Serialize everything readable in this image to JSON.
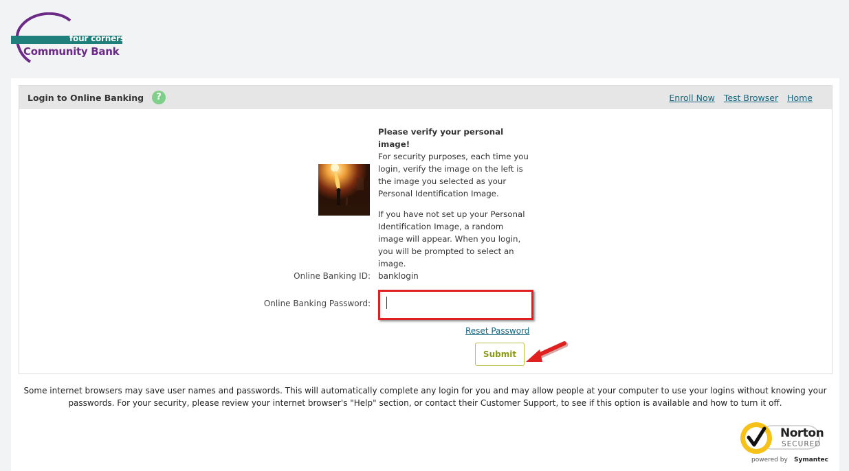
{
  "logo": {
    "line1": "four corners",
    "line2": "Community Bank"
  },
  "header": {
    "title": "Login to Online Banking",
    "help_icon": "?",
    "links": [
      "Enroll Now",
      "Test Browser",
      "Home"
    ]
  },
  "verify": {
    "heading": "Please verify your personal image!",
    "para1": "For security purposes, each time you login, verify the image on the left is the image you selected as your Personal Identification Image.",
    "para2": "If you have not set up your Personal Identification Image, a random image will appear. When you login, you will be prompted to select an image."
  },
  "form": {
    "id_label": "Online Banking ID:",
    "id_value": "banklogin",
    "password_label": "Online Banking Password:",
    "password_value": "",
    "reset_label": "Reset Password",
    "submit_label": "Submit"
  },
  "notice": "Some internet browsers may save user names and passwords. This will automatically complete any login for you and may allow people at your computer to use your logins without knowing your passwords. For your security, please review your internet browser's \"Help\" section, or contact their Customer Support, to see if this option is available and how to turn it off.",
  "norton": {
    "brand": "Norton",
    "secured": "SECURED",
    "powered_prefix": "powered by",
    "powered_brand": "Symantec"
  },
  "colors": {
    "accent_teal": "#1f7f7a",
    "brand_purple": "#6b2a86",
    "link": "#15657d",
    "highlight_red": "#e02020",
    "submit_text": "#8a9a16"
  }
}
